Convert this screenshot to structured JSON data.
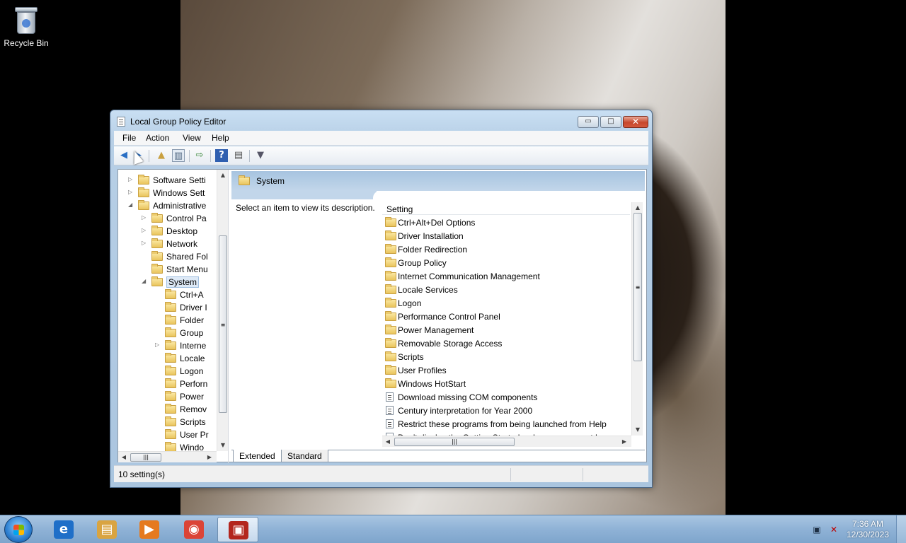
{
  "desktop": {
    "icons": [
      {
        "label": "Recycle Bin",
        "icon": "recycle-bin-icon"
      }
    ]
  },
  "window": {
    "title": "Local Group Policy Editor",
    "controls": {
      "minimize": "▭",
      "maximize": "□",
      "close": "✕"
    }
  },
  "menu": {
    "file": "File",
    "action": "Action",
    "view": "View",
    "help": "Help"
  },
  "toolbar": {
    "back": "back-icon",
    "forward": "forward-icon",
    "up": "up-folder-icon",
    "show_hide_tree": "tree-toggle-icon",
    "export": "export-icon",
    "help": "help-icon",
    "properties": "properties-icon",
    "filter": "filter-icon"
  },
  "tree": {
    "items": [
      {
        "label": "Software Setti",
        "level": 1,
        "expander": "▷"
      },
      {
        "label": "Windows Sett",
        "level": 1,
        "expander": "▷"
      },
      {
        "label": "Administrative",
        "level": 1,
        "expander": "◢"
      },
      {
        "label": "Control Pa",
        "level": 2,
        "expander": "▷"
      },
      {
        "label": "Desktop",
        "level": 2,
        "expander": "▷"
      },
      {
        "label": "Network",
        "level": 2,
        "expander": "▷"
      },
      {
        "label": "Shared Fol",
        "level": 2,
        "expander": ""
      },
      {
        "label": "Start Menu",
        "level": 2,
        "expander": ""
      },
      {
        "label": "System",
        "level": 2,
        "expander": "◢",
        "selected": true
      },
      {
        "label": "Ctrl+A",
        "level": 3,
        "expander": ""
      },
      {
        "label": "Driver I",
        "level": 3,
        "expander": ""
      },
      {
        "label": "Folder",
        "level": 3,
        "expander": ""
      },
      {
        "label": "Group",
        "level": 3,
        "expander": ""
      },
      {
        "label": "Interne",
        "level": 3,
        "expander": "▷"
      },
      {
        "label": "Locale",
        "level": 3,
        "expander": ""
      },
      {
        "label": "Logon",
        "level": 3,
        "expander": ""
      },
      {
        "label": "Perforn",
        "level": 3,
        "expander": ""
      },
      {
        "label": "Power",
        "level": 3,
        "expander": ""
      },
      {
        "label": "Remov",
        "level": 3,
        "expander": ""
      },
      {
        "label": "Scripts",
        "level": 3,
        "expander": ""
      },
      {
        "label": "User Pr",
        "level": 3,
        "expander": ""
      },
      {
        "label": "Windo",
        "level": 3,
        "expander": ""
      }
    ]
  },
  "scroll": {
    "up": "▲",
    "down": "▼",
    "left": "◀",
    "right": "▶",
    "grip_v": "≡",
    "grip_h": "|||"
  },
  "details": {
    "header": "System",
    "description": "Select an item to view its description.",
    "column": "Setting",
    "rows": [
      {
        "label": "Ctrl+Alt+Del Options",
        "type": "folder"
      },
      {
        "label": "Driver Installation",
        "type": "folder"
      },
      {
        "label": "Folder Redirection",
        "type": "folder"
      },
      {
        "label": "Group Policy",
        "type": "folder"
      },
      {
        "label": "Internet Communication Management",
        "type": "folder"
      },
      {
        "label": "Locale Services",
        "type": "folder"
      },
      {
        "label": "Logon",
        "type": "folder"
      },
      {
        "label": "Performance Control Panel",
        "type": "folder"
      },
      {
        "label": "Power Management",
        "type": "folder"
      },
      {
        "label": "Removable Storage Access",
        "type": "folder"
      },
      {
        "label": "Scripts",
        "type": "folder"
      },
      {
        "label": "User Profiles",
        "type": "folder"
      },
      {
        "label": "Windows HotStart",
        "type": "folder"
      },
      {
        "label": "Download missing COM components",
        "type": "policy"
      },
      {
        "label": "Century interpretation for Year 2000",
        "type": "policy"
      },
      {
        "label": "Restrict these programs from being launched from Help",
        "type": "policy"
      },
      {
        "label": "Don't display the Getting Started welcome screen at logon",
        "type": "policy"
      }
    ]
  },
  "tabs": {
    "extended": "Extended",
    "standard": "Standard"
  },
  "status": {
    "text": "10 setting(s)"
  },
  "taskbar": {
    "apps": [
      {
        "name": "internet-explorer",
        "glyph": "e",
        "color": "#1f6fc8"
      },
      {
        "name": "file-explorer",
        "glyph": "▤",
        "color": "#d9a441"
      },
      {
        "name": "media-player",
        "glyph": "▶",
        "color": "#e57a1f"
      },
      {
        "name": "chrome",
        "glyph": "◉",
        "color": "#db4437"
      },
      {
        "name": "group-policy-editor",
        "glyph": "▣",
        "color": "#b3261e"
      }
    ],
    "tray": {
      "network": "▣",
      "volume": "🔇"
    },
    "clock": {
      "time": "7:36 AM",
      "date": "12/30/2023"
    }
  },
  "colors": {
    "window_frame": "#b7cfe6",
    "details_header": "#a7c4e0",
    "taskbar": "#8fb2d6",
    "close_button": "#c7472c"
  }
}
